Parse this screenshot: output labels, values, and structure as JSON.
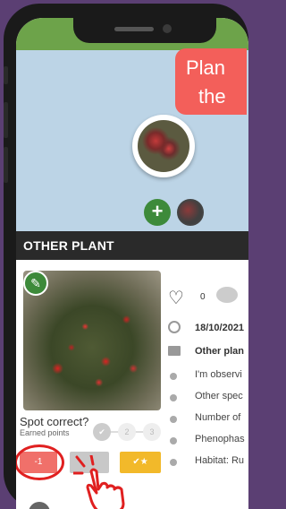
{
  "header": {
    "title": "OTHER PLANT"
  },
  "callout": {
    "line1": "Plan",
    "line2": "the"
  },
  "observation": {
    "likes": "0",
    "date": "18/10/2021",
    "category": "Other plan",
    "items": [
      "I'm observi",
      "Other spec",
      "Number of",
      "Phenophas",
      "Habitat: Ru"
    ]
  },
  "review": {
    "question": "Spot correct?",
    "points": "Earned points",
    "steps": [
      "1",
      "2",
      "3"
    ],
    "chips": {
      "minus": "-1",
      "mid": "",
      "check": "✔"
    }
  },
  "colors": {
    "accent_green": "#3d8a3a",
    "callout_red": "#f35f5a",
    "highlight_red": "#e02020"
  }
}
